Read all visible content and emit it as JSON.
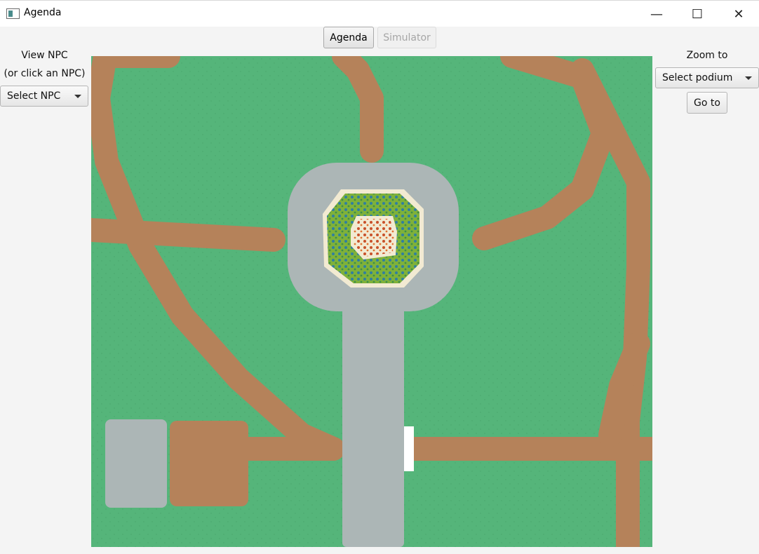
{
  "window": {
    "title": "Agenda",
    "icon": "app-window-icon",
    "controls": {
      "minimize": "—",
      "maximize": "☐",
      "close": "✕"
    }
  },
  "tabs": [
    {
      "label": "Agenda",
      "state": "active"
    },
    {
      "label": "Simulator",
      "state": "disabled"
    }
  ],
  "left_panel": {
    "view_label": "View NPC",
    "hint_label": "(or click an NPC)",
    "npc_select": {
      "value": "Select NPC"
    }
  },
  "right_panel": {
    "zoom_label": "Zoom to",
    "podium_select": {
      "value": "Select podium"
    },
    "goto_label": "Go to"
  },
  "map": {
    "colors": {
      "grass": "#55b57a",
      "dirt_path": "#b5825a",
      "stone_plaza": "#acb6b6",
      "garden_grass": "#7fb13a",
      "garden_flowers": "#c8502a",
      "garden_border": "#f2ead2"
    }
  }
}
